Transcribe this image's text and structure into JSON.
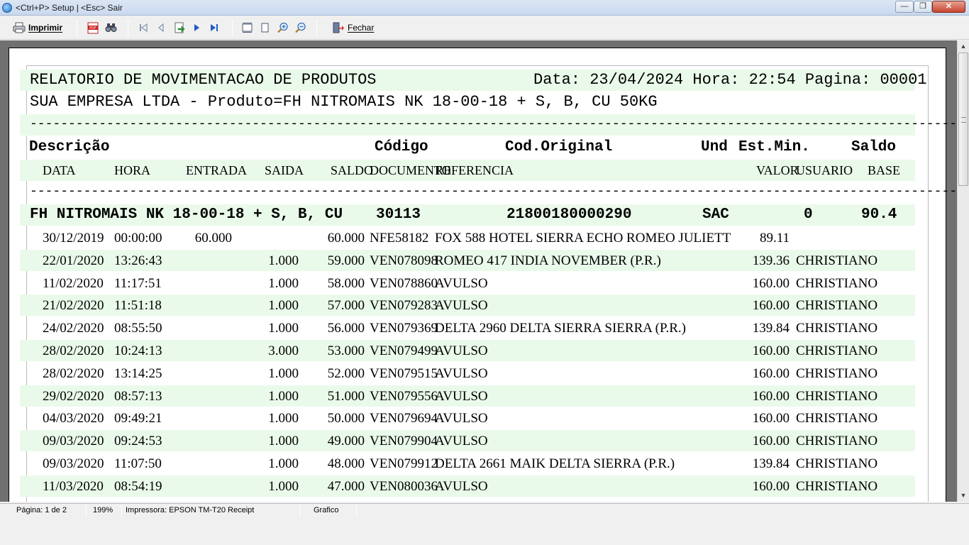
{
  "window": {
    "title": "<Ctrl+P> Setup | <Esc> Sair"
  },
  "toolbar": {
    "print_label": "Imprimir",
    "close_label": "Fechar"
  },
  "report": {
    "title": "RELATORIO DE MOVIMENTACAO DE PRODUTOS",
    "date_info": "Data: 23/04/2024 Hora: 22:54 Pagina: 00001",
    "subtitle": "SUA EMPRESA LTDA - Produto=FH NITROMAIS NK 18-00-18 + S, B, CU 50KG",
    "dashes": "-------------------------------------------------------------------------------------------------------------------------------",
    "headers": {
      "descricao": "Descrição",
      "codigo": "Código",
      "cod_original": "Cod.Original",
      "und": "Und",
      "est_min": "Est.Min.",
      "saldo": "Saldo"
    },
    "columns": {
      "data": "DATA",
      "hora": "HORA",
      "entrada": "ENTRADA",
      "saida": "SAIDA",
      "saldo": "SALDO",
      "documento": "DOCUMENTO",
      "referencia": "REFERENCIA",
      "valor": "VALOR",
      "usuario": "USUARIO",
      "base": "BASE"
    },
    "product": {
      "descricao": "FH NITROMAIS NK 18-00-18 + S, B, CU",
      "codigo": "30113",
      "cod_original": "21800180000290",
      "und": "SAC",
      "est_min": "0",
      "saldo": "90.4"
    },
    "rows": [
      {
        "data": "30/12/2019",
        "hora": "00:00:00",
        "entrada": "60.000",
        "saida": "",
        "saldo": "60.000",
        "doc": "NFE58182",
        "ref": "FOX 588 HOTEL SIERRA ECHO ROMEO JULIETT",
        "valor": "89.11",
        "usuario": ""
      },
      {
        "data": "22/01/2020",
        "hora": "13:26:43",
        "entrada": "",
        "saida": "1.000",
        "saldo": "59.000",
        "doc": "VEN078098",
        "ref": "ROMEO 417 INDIA NOVEMBER (P.R.)",
        "valor": "139.36",
        "usuario": "CHRISTIANO"
      },
      {
        "data": "11/02/2020",
        "hora": "11:17:51",
        "entrada": "",
        "saida": "1.000",
        "saldo": "58.000",
        "doc": "VEN078860",
        "ref": "AVULSO",
        "valor": "160.00",
        "usuario": "CHRISTIANO"
      },
      {
        "data": "21/02/2020",
        "hora": "11:51:18",
        "entrada": "",
        "saida": "1.000",
        "saldo": "57.000",
        "doc": "VEN079283",
        "ref": "AVULSO",
        "valor": "160.00",
        "usuario": "CHRISTIANO"
      },
      {
        "data": "24/02/2020",
        "hora": "08:55:50",
        "entrada": "",
        "saida": "1.000",
        "saldo": "56.000",
        "doc": "VEN079369",
        "ref": "DELTA 2960 DELTA SIERRA SIERRA (P.R.)",
        "valor": "139.84",
        "usuario": "CHRISTIANO"
      },
      {
        "data": "28/02/2020",
        "hora": "10:24:13",
        "entrada": "",
        "saida": "3.000",
        "saldo": "53.000",
        "doc": "VEN079499",
        "ref": "AVULSO",
        "valor": "160.00",
        "usuario": "CHRISTIANO"
      },
      {
        "data": "28/02/2020",
        "hora": "13:14:25",
        "entrada": "",
        "saida": "1.000",
        "saldo": "52.000",
        "doc": "VEN079515",
        "ref": "AVULSO",
        "valor": "160.00",
        "usuario": "CHRISTIANO"
      },
      {
        "data": "29/02/2020",
        "hora": "08:57:13",
        "entrada": "",
        "saida": "1.000",
        "saldo": "51.000",
        "doc": "VEN079556",
        "ref": "AVULSO",
        "valor": "160.00",
        "usuario": "CHRISTIANO"
      },
      {
        "data": "04/03/2020",
        "hora": "09:49:21",
        "entrada": "",
        "saida": "1.000",
        "saldo": "50.000",
        "doc": "VEN079694",
        "ref": "AVULSO",
        "valor": "160.00",
        "usuario": "CHRISTIANO"
      },
      {
        "data": "09/03/2020",
        "hora": "09:24:53",
        "entrada": "",
        "saida": "1.000",
        "saldo": "49.000",
        "doc": "VEN079904",
        "ref": "AVULSO",
        "valor": "160.00",
        "usuario": "CHRISTIANO"
      },
      {
        "data": "09/03/2020",
        "hora": "11:07:50",
        "entrada": "",
        "saida": "1.000",
        "saldo": "48.000",
        "doc": "VEN079912",
        "ref": "DELTA 2661 MAIK DELTA SIERRA (P.R.)",
        "valor": "139.84",
        "usuario": "CHRISTIANO"
      },
      {
        "data": "11/03/2020",
        "hora": "08:54:19",
        "entrada": "",
        "saida": "1.000",
        "saldo": "47.000",
        "doc": "VEN080036",
        "ref": "AVULSO",
        "valor": "160.00",
        "usuario": "CHRISTIANO"
      }
    ]
  },
  "statusbar": {
    "page": "Página: 1 de 2",
    "zoom": "199%",
    "printer": "Impressora: EPSON TM-T20 Receipt",
    "mode": "Grafico"
  }
}
